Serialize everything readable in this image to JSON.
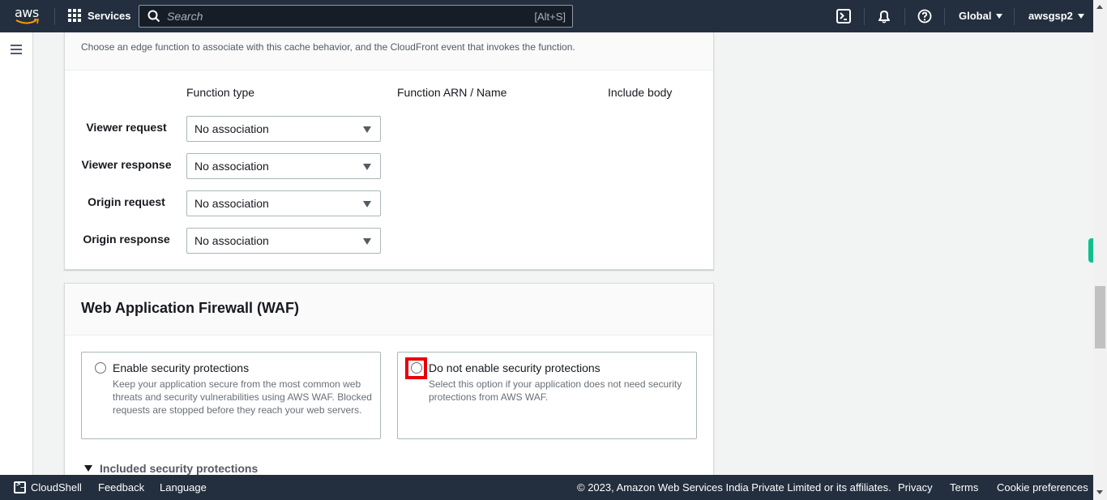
{
  "topnav": {
    "logo": "aws",
    "services_label": "Services",
    "search_placeholder": "Search",
    "search_shortcut": "[Alt+S]",
    "icons": [
      "cloudshell-icon",
      "notifications-icon",
      "help-icon"
    ],
    "region_label": "Global",
    "account_label": "awsgsp2"
  },
  "edge_functions": {
    "description": "Choose an edge function to associate with this cache behavior, and the CloudFront event that invokes the function.",
    "columns": [
      "Function type",
      "Function ARN / Name",
      "Include body"
    ],
    "rows": [
      {
        "label": "Viewer request",
        "value": "No association"
      },
      {
        "label": "Viewer response",
        "value": "No association"
      },
      {
        "label": "Origin request",
        "value": "No association"
      },
      {
        "label": "Origin response",
        "value": "No association"
      }
    ]
  },
  "waf": {
    "title": "Web Application Firewall (WAF)",
    "options": [
      {
        "label": "Enable security protections",
        "description": "Keep your application secure from the most common web threats and security vulnerabilities using AWS WAF. Blocked requests are stopped before they reach your web servers.",
        "selected": false
      },
      {
        "label": "Do not enable security protections",
        "description": "Select this option if your application does not need security protections from AWS WAF.",
        "selected": false
      }
    ],
    "expander_label": "Included security protections"
  },
  "footer": {
    "cloudshell": "CloudShell",
    "feedback": "Feedback",
    "language": "Language",
    "copyright": "© 2023, Amazon Web Services India Private Limited or its affiliates.",
    "privacy": "Privacy",
    "terms": "Terms",
    "cookie": "Cookie preferences"
  },
  "colors": {
    "nav_bg": "#232f3e",
    "highlight": "#e8000b",
    "feedback_tab": "#0fc08c"
  }
}
